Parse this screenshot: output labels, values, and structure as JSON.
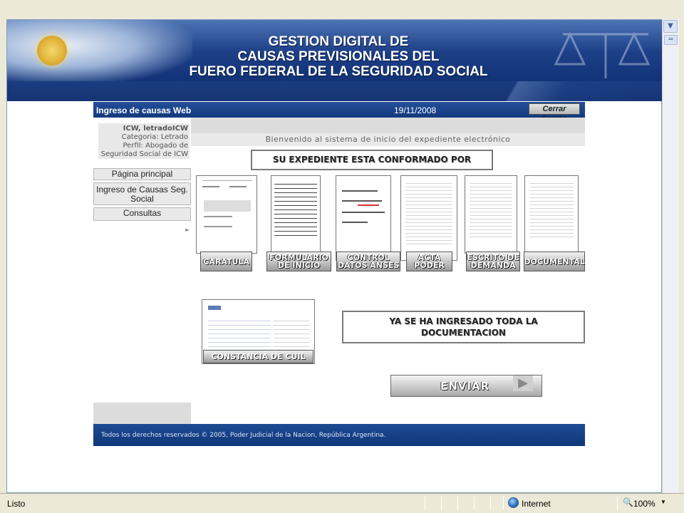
{
  "banner": {
    "line1": "GESTION DIGITAL DE",
    "line2": "CAUSAS PREVISIONALES DEL",
    "line3": "FUERO FEDERAL DE LA SEGURIDAD SOCIAL"
  },
  "header": {
    "title": "Ingreso de causas Web",
    "date": "19/11/2008",
    "logout_label": "Cerrar Sesión"
  },
  "user": {
    "name": "ICW, letradoICW",
    "category": "Categoria: Letrado",
    "profile_line1": "Perfil: Abogado de",
    "profile_line2": "Seguridad Social de ICW"
  },
  "nav": {
    "home": "Página principal",
    "ingreso_line1": "Ingreso de Causas Seg.",
    "ingreso_line2": "Social",
    "consultas": "Consultas"
  },
  "main": {
    "welcome": "Bienvenido al sistema de inicio del expediente electrónico",
    "expediente_heading": "SU EXPEDIENTE ESTA CONFORMADO POR",
    "documents": [
      {
        "line1": "CARATULA",
        "line2": ""
      },
      {
        "line1": "FORMULARIO",
        "line2": "DE INICIO"
      },
      {
        "line1": "CONTROL",
        "line2": "DATOS ANSES"
      },
      {
        "line1": "ACTA",
        "line2": "PODER"
      },
      {
        "line1": "ESCRITO DE",
        "line2": "DEMANDA"
      },
      {
        "line1": "DOCUMENTAL",
        "line2": ""
      }
    ],
    "cuil_label": "CONSTANCIA DE CUIL",
    "complete_line1": "YA SE HA INGRESADO TODA LA",
    "complete_line2": "DOCUMENTACION",
    "send_label": "ENVIAR"
  },
  "footer": {
    "copyright": "Todos los derechos reservados © 2005, Poder Judicial de la Nacion, República Argentina."
  },
  "statusbar": {
    "status": "Listo",
    "zone": "Internet",
    "zoom": "100%"
  },
  "colors": {
    "banner": "#1c3f87",
    "header": "#244e98",
    "footer": "#1e4a94"
  }
}
